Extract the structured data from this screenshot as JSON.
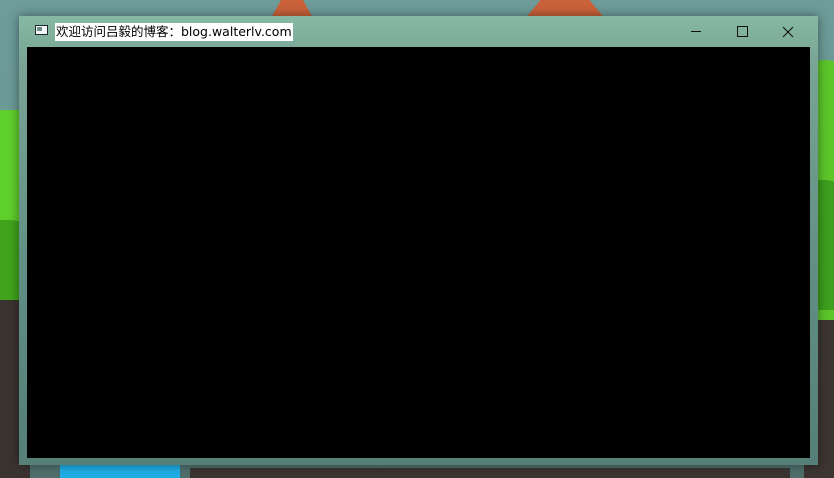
{
  "window": {
    "title": "欢迎访问吕毅的博客：blog.walterlv.com",
    "icon": "window-app-icon"
  },
  "titlebar_controls": {
    "minimize_icon": "minimize-icon",
    "maximize_icon": "maximize-icon",
    "close_icon": "close-icon"
  },
  "client_area": {
    "background": "#000000"
  },
  "colors": {
    "frame": "#6f9c8f",
    "client": "#000000",
    "title_highlight": "#ffffff"
  }
}
